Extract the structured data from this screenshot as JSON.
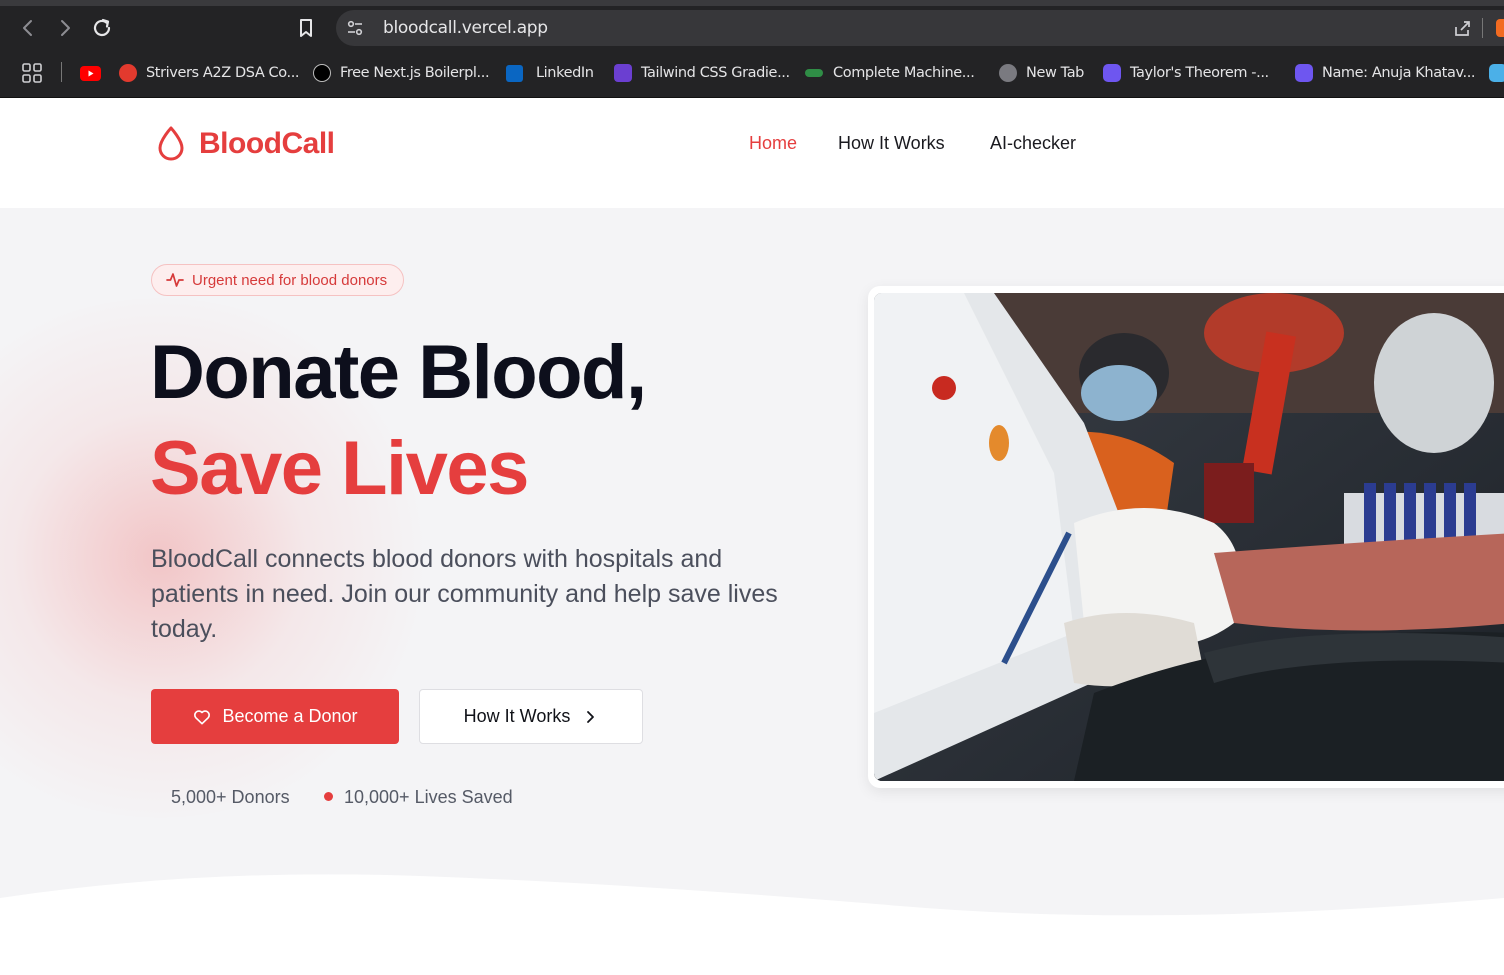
{
  "browser": {
    "url": "bloodcall.vercel.app",
    "bookmarks": [
      {
        "label": "Strivers A2Z DSA Co...",
        "icon": "tuf-icon"
      },
      {
        "label": "Free Next.js Boilerpl...",
        "icon": "nextjs-icon"
      },
      {
        "label": "LinkedIn",
        "icon": "linkedin-icon"
      },
      {
        "label": "Tailwind CSS Gradie...",
        "icon": "gradient-icon"
      },
      {
        "label": "Complete Machine...",
        "icon": "gfg-icon"
      },
      {
        "label": "New Tab",
        "icon": "globe-icon"
      },
      {
        "label": "Taylor's Theorem -...",
        "icon": "app-icon"
      },
      {
        "label": "Name: Anuja Khatav...",
        "icon": "app-icon"
      }
    ]
  },
  "header": {
    "logo_text": "BloodCall",
    "nav": [
      {
        "label": "Home",
        "active": true
      },
      {
        "label": "How It Works",
        "active": false
      },
      {
        "label": "AI-checker",
        "active": false
      }
    ]
  },
  "hero": {
    "badge": "Urgent need for blood donors",
    "title_line1": "Donate Blood,",
    "title_line2": "Save Lives",
    "description": "BloodCall connects blood donors with hospitals and patients in need. Join our community and help save lives today.",
    "primary_button": "Become a Donor",
    "secondary_button": "How It Works",
    "stats": [
      "5,000+ Donors",
      "10,000+ Lives Saved"
    ]
  },
  "colors": {
    "brand": "#e53e3e",
    "heading": "#0d0f1c",
    "body_text": "#4b4f5c"
  }
}
